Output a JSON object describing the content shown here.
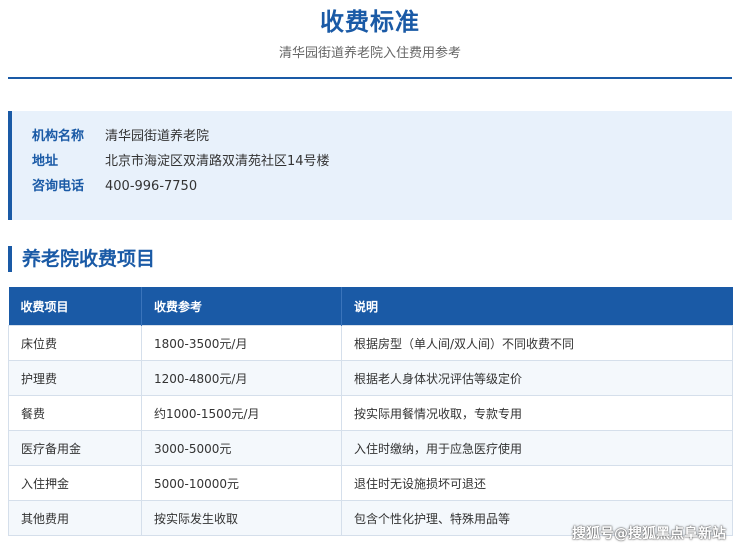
{
  "header": {
    "title": "收费标准",
    "subtitle": "清华园街道养老院入住费用参考"
  },
  "info": {
    "rows": [
      {
        "label": "机构名称",
        "value": "清华园街道养老院"
      },
      {
        "label": "地址",
        "value": "北京市海淀区双清路双清苑社区14号楼"
      },
      {
        "label": "咨询电话",
        "value": "400-996-7750"
      }
    ]
  },
  "section": {
    "title": "养老院收费项目"
  },
  "table": {
    "headers": [
      "收费项目",
      "收费参考",
      "说明"
    ],
    "rows": [
      [
        "床位费",
        "1800-3500元/月",
        "根据房型（单人间/双人间）不同收费不同"
      ],
      [
        "护理费",
        "1200-4800元/月",
        "根据老人身体状况评估等级定价"
      ],
      [
        "餐费",
        "约1000-1500元/月",
        "按实际用餐情况收取，专款专用"
      ],
      [
        "医疗备用金",
        "3000-5000元",
        "入住时缴纳，用于应急医疗使用"
      ],
      [
        "入住押金",
        "5000-10000元",
        "退住时无设施损坏可退还"
      ],
      [
        "其他费用",
        "按实际发生收取",
        "包含个性化护理、特殊用品等"
      ]
    ]
  },
  "watermark": "搜狐号@搜狐黑点阜新站"
}
